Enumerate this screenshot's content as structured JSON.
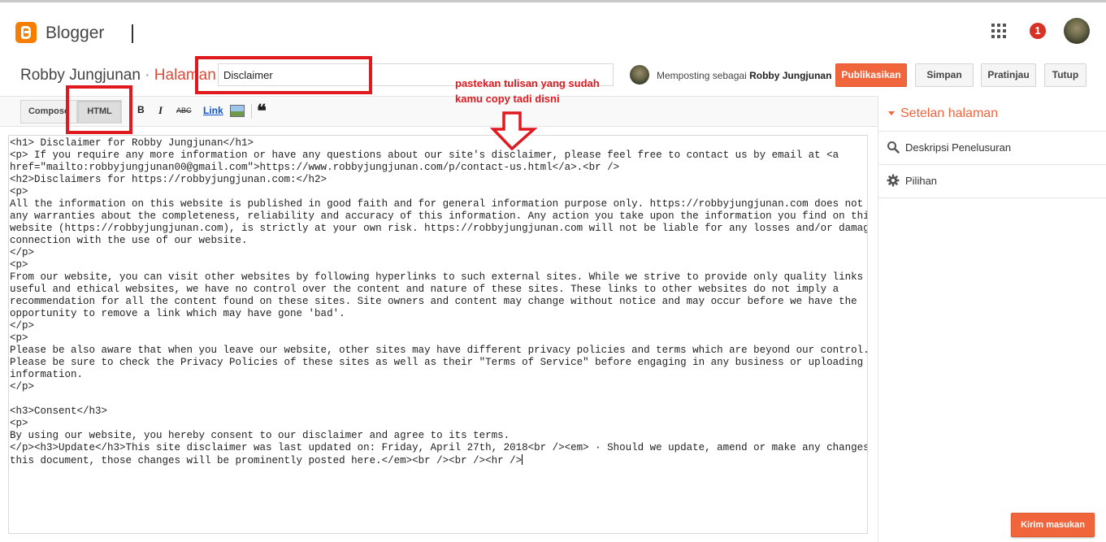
{
  "header": {
    "brand": "Blogger",
    "notification_count": "1",
    "icons": {
      "logo": "blogger-logo-icon",
      "apps": "apps-grid-icon",
      "avatar": "user-avatar"
    }
  },
  "page_bar": {
    "blog_name": "Robby Jungjunan",
    "separator": "·",
    "section": "Halaman",
    "title_value": "Disclaimer",
    "posting_as_prefix": "Memposting sebagai",
    "posting_as_user": "Robby Jungjunan",
    "buttons": {
      "publish": "Publikasikan",
      "save": "Simpan",
      "preview": "Pratinjau",
      "close": "Tutup"
    }
  },
  "annotation": {
    "line1": "pastekan tulisan yang sudah",
    "line2": "kamu copy tadi disni",
    "color": "#e0191f"
  },
  "toolbar": {
    "compose_tab": "Compose",
    "html_tab": "HTML",
    "bold": "B",
    "italic": "I",
    "strike": "ABC",
    "link": "Link",
    "quote": "❝"
  },
  "editor": {
    "lines": [
      "<h1> Disclaimer for Robby Jungjunan</h1>",
      "<p> If you require any more information or have any questions about our site's disclaimer, please feel free to contact us by email at <a",
      "href=\"mailto:robbyjungjunan00@gmail.com\">https://www.robbyjungjunan.com/p/contact-us.html</a>.<br />",
      "<h2>Disclaimers for https://robbyjungjunan.com:</h2>",
      "<p>",
      "All the information on this website is published in good faith and for general information purpose only. https://robbyjungjunan.com does not make",
      "any warranties about the completeness, reliability and accuracy of this information. Any action you take upon the information you find on this",
      "website (https://robbyjungjunan.com), is strictly at your own risk. https://robbyjungjunan.com will not be liable for any losses and/or damages in",
      "connection with the use of our website.",
      "</p>",
      "<p>",
      "From our website, you can visit other websites by following hyperlinks to such external sites. While we strive to provide only quality links to",
      "useful and ethical websites, we have no control over the content and nature of these sites. These links to other websites do not imply a",
      "recommendation for all the content found on these sites. Site owners and content may change without notice and may occur before we have the",
      "opportunity to remove a link which may have gone 'bad'.",
      "</p>",
      "<p>",
      "Please be also aware that when you leave our website, other sites may have different privacy policies and terms which are beyond our control.",
      "Please be sure to check the Privacy Policies of these sites as well as their \"Terms of Service\" before engaging in any business or uploading any",
      "information.",
      "</p>",
      "",
      "<h3>Consent</h3>",
      "<p>",
      "By using our website, you hereby consent to our disclaimer and agree to its terms.",
      "</p><h3>Update</h3>This site disclaimer was last updated on: Friday, April 27th, 2018<br /><em> · Should we update, amend or make any changes to",
      "this document, those changes will be prominently posted here.</em><br /><br /><hr />"
    ]
  },
  "sidebar": {
    "heading": "Setelan halaman",
    "items": [
      {
        "label": "Deskripsi Penelusuran",
        "icon": "search-icon"
      },
      {
        "label": "Pilihan",
        "icon": "gear-icon"
      }
    ]
  },
  "feedback": {
    "label": "Kirim masukan"
  }
}
